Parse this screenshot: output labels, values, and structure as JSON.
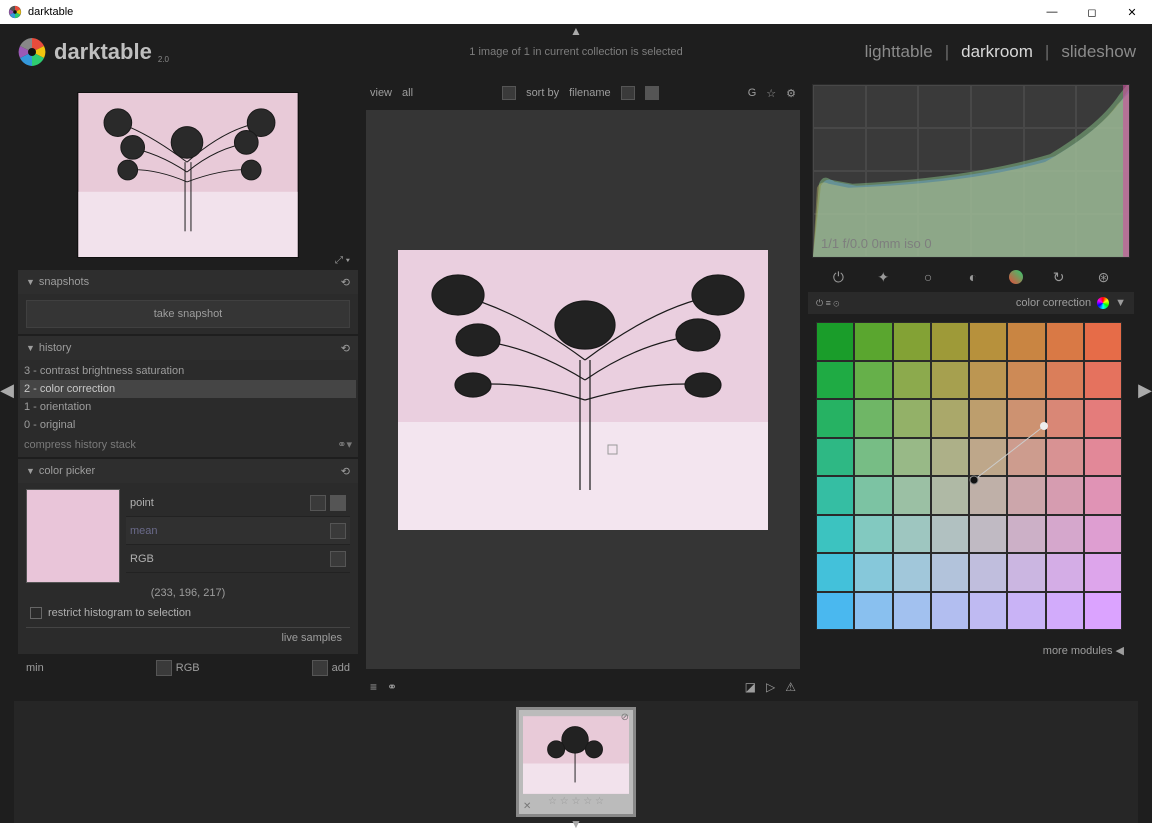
{
  "window": {
    "title": "darktable"
  },
  "logo": {
    "name": "darktable",
    "version": "2.0"
  },
  "header": {
    "status": "1 image of 1 in current collection is selected",
    "tabs": [
      "lighttable",
      "darkroom",
      "slideshow"
    ],
    "active": 1
  },
  "left": {
    "snapshots": {
      "title": "snapshots",
      "button": "take snapshot"
    },
    "history": {
      "title": "history",
      "items": [
        "3 - contrast brightness saturation",
        "2 - color correction",
        "1 - orientation",
        "0 - original"
      ],
      "selected": 1,
      "compress": "compress history stack"
    },
    "colorpicker": {
      "title": "color picker",
      "point": "point",
      "mean": "mean",
      "rgb": "RGB",
      "value": "(233, 196, 217)",
      "restrict": "restrict histogram to selection",
      "live": "live samples",
      "min": "min",
      "rgb2": "RGB",
      "add": "add"
    }
  },
  "toolbar": {
    "view": "view",
    "all": "all",
    "sortby": "sort by",
    "filename": "filename",
    "g": "G"
  },
  "histogram": {
    "info": "1/1 f/0.0 0mm iso 0"
  },
  "module": {
    "title": "color correction"
  },
  "more": {
    "label": "more modules"
  },
  "colorgrid": [
    [
      "#1a9d2a",
      "#5aa62f",
      "#83a235",
      "#9e9a38",
      "#b7913c",
      "#c98542",
      "#d97945",
      "#e66c48"
    ],
    [
      "#1fab44",
      "#66b04a",
      "#8caa4d",
      "#a6a04f",
      "#bc9652",
      "#cd8a56",
      "#da7e5a",
      "#e5725e"
    ],
    [
      "#26b263",
      "#6fb666",
      "#93b168",
      "#aaa86a",
      "#bd9e6d",
      "#cd9271",
      "#d98776",
      "#e47c7b"
    ],
    [
      "#2eb884",
      "#77bd85",
      "#98b987",
      "#adb088",
      "#bea78a",
      "#cd9c8e",
      "#d89293",
      "#e28898"
    ],
    [
      "#35bea3",
      "#7cc3a3",
      "#9bc0a4",
      "#afb9a5",
      "#bfb0a8",
      "#ccA6ab",
      "#d69cb0",
      "#e093b5"
    ],
    [
      "#3cc3c0",
      "#82c9c0",
      "#9ec6c0",
      "#b1c1c1",
      "#c0bac3",
      "#ccb0c7",
      "#d5a7cc",
      "#de9ed1"
    ],
    [
      "#43c1da",
      "#86c8da",
      "#a1c7da",
      "#b2c3db",
      "#c0bedd",
      "#cbb6e1",
      "#d4ade6",
      "#dda5eb"
    ],
    [
      "#4ab8ef",
      "#89c0ef",
      "#a2c1ef",
      "#b2bef0",
      "#bfbaf2",
      "#c9b3f6",
      "#d2abfb",
      "#dba3ff"
    ]
  ]
}
